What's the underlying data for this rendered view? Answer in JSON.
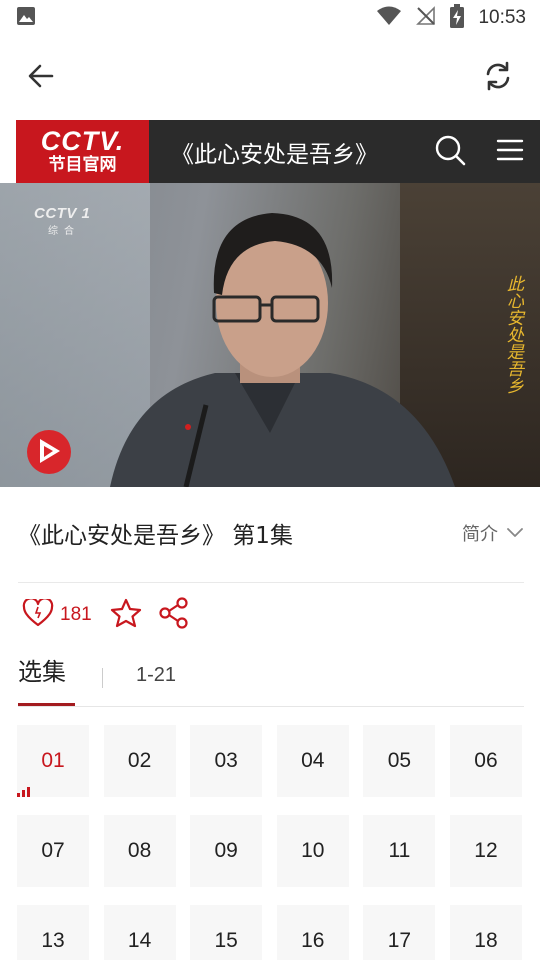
{
  "status_bar": {
    "time": "10:53",
    "icons": [
      "image-icon",
      "wifi-icon",
      "no-signal-icon",
      "battery-charging-icon"
    ]
  },
  "app_bar": {
    "icons": [
      "back-arrow-icon",
      "refresh-icon"
    ]
  },
  "site_header": {
    "logo_line1": "CCTV.",
    "logo_line2": "节目官网",
    "title": "《此心安处是吾乡》",
    "icons": [
      "search-icon",
      "menu-icon"
    ]
  },
  "video": {
    "channel_logo": "CCTV 1",
    "channel_sub": "综合",
    "watermark": "此心安处是吾乡"
  },
  "episode": {
    "title": "《此心安处是吾乡》 第1集",
    "intro_label": "简介"
  },
  "actions": {
    "like_count": "181",
    "icons": [
      "heart-icon",
      "star-icon",
      "share-icon"
    ]
  },
  "tabs": {
    "episodes_label": "选集",
    "range_label": "1-21"
  },
  "episodes": [
    "01",
    "02",
    "03",
    "04",
    "05",
    "06",
    "07",
    "08",
    "09",
    "10",
    "11",
    "12",
    "13",
    "14",
    "15",
    "16",
    "17",
    "18"
  ],
  "active_episode": "01",
  "colors": {
    "brand_red": "#c8171e",
    "header_dark": "#2b2b2b",
    "tab_underline": "#a31b1f"
  }
}
